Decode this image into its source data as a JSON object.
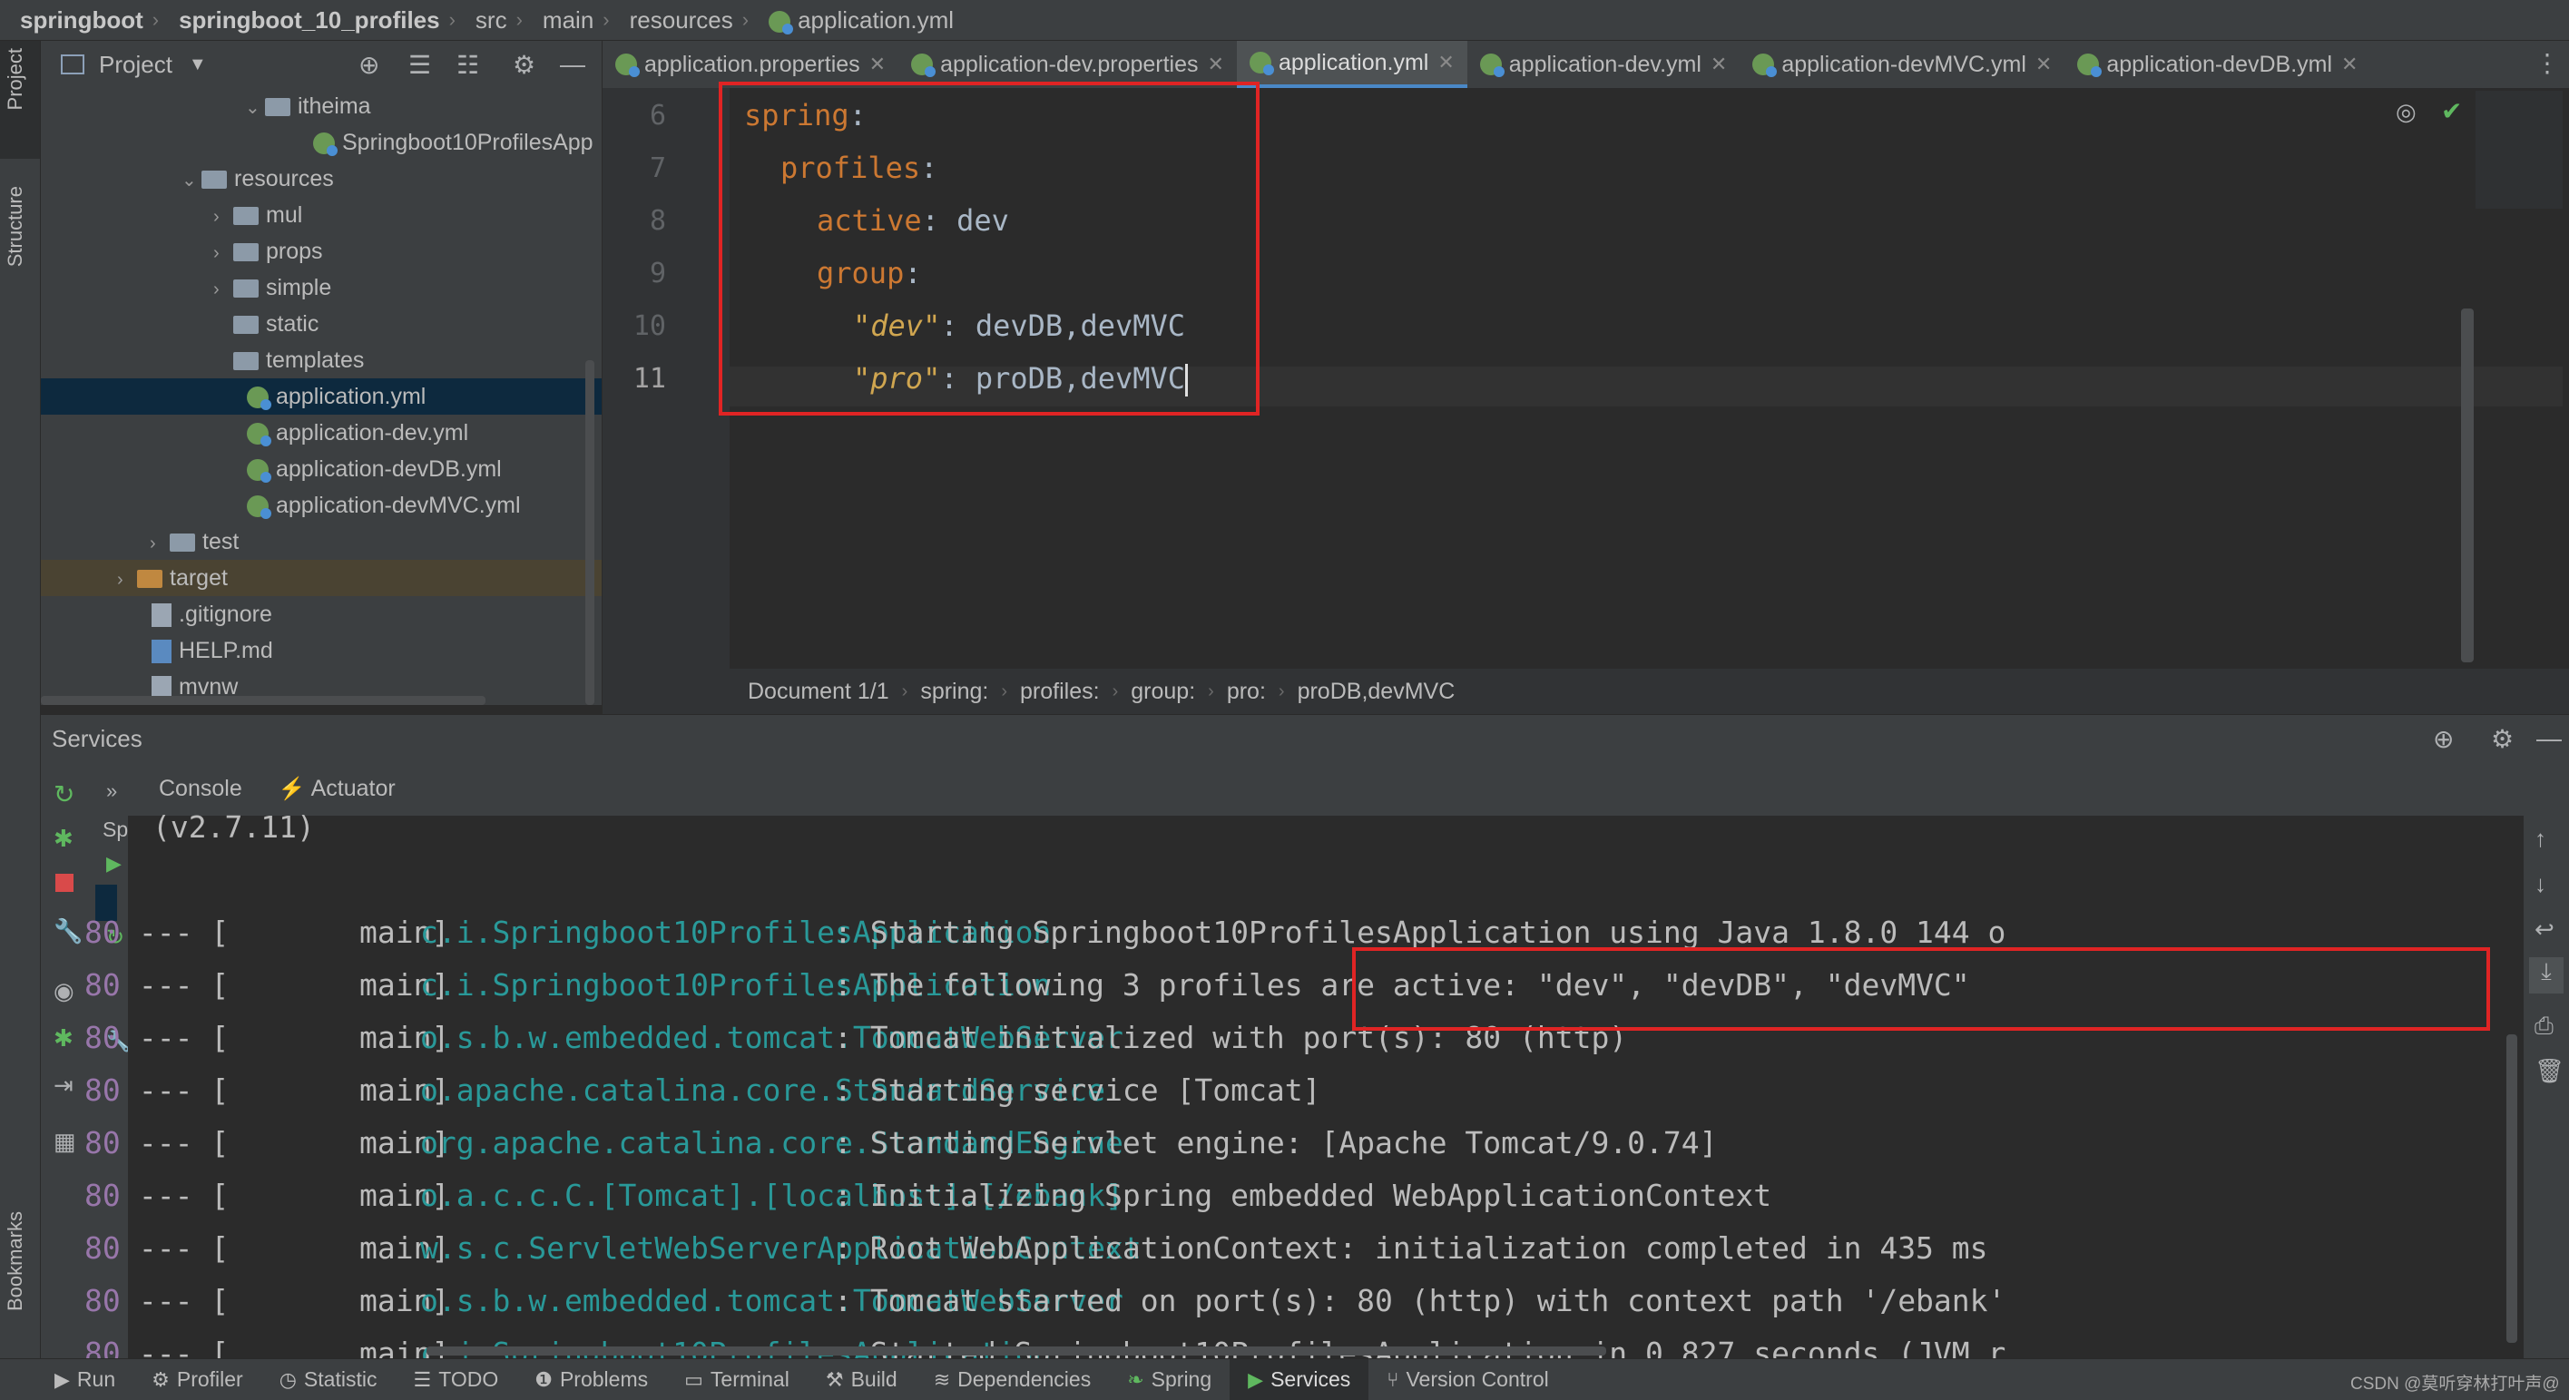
{
  "breadcrumb": [
    "springboot",
    "springboot_10_profiles",
    "src",
    "main",
    "resources",
    "application.yml"
  ],
  "left_strip": {
    "project_label": "Project",
    "structure_label": "Structure",
    "bookmarks_label": "Bookmarks"
  },
  "project_panel": {
    "title": "Project",
    "tree": [
      {
        "label": "itheima",
        "type": "folder",
        "expanded": true
      },
      {
        "label": "Springboot10ProfilesApp",
        "type": "spring-class"
      },
      {
        "label": "resources",
        "type": "folder",
        "expanded": true
      },
      {
        "label": "mul",
        "type": "folder",
        "expanded": false
      },
      {
        "label": "props",
        "type": "folder",
        "expanded": false
      },
      {
        "label": "simple",
        "type": "folder",
        "expanded": false
      },
      {
        "label": "static",
        "type": "folder"
      },
      {
        "label": "templates",
        "type": "folder"
      },
      {
        "label": "application.yml",
        "type": "spring-yml",
        "selected": true
      },
      {
        "label": "application-dev.yml",
        "type": "spring-yml"
      },
      {
        "label": "application-devDB.yml",
        "type": "spring-yml"
      },
      {
        "label": "application-devMVC.yml",
        "type": "spring-yml"
      },
      {
        "label": "test",
        "type": "folder",
        "expanded": false
      },
      {
        "label": "target",
        "type": "folder-orange",
        "expanded": false
      },
      {
        "label": ".gitignore",
        "type": "file"
      },
      {
        "label": "HELP.md",
        "type": "file"
      },
      {
        "label": "mvnw",
        "type": "file"
      }
    ]
  },
  "tabs": [
    {
      "label": "application.properties",
      "active": false
    },
    {
      "label": "application-dev.properties",
      "active": false
    },
    {
      "label": "application.yml",
      "active": true
    },
    {
      "label": "application-dev.yml",
      "active": false
    },
    {
      "label": "application-devMVC.yml",
      "active": false
    },
    {
      "label": "application-devDB.yml",
      "active": false
    }
  ],
  "editor": {
    "line_numbers": [
      "6",
      "7",
      "8",
      "9",
      "10",
      "11"
    ],
    "current_line": "11",
    "lines": [
      {
        "key": "spring",
        "sep": ":",
        "value": ""
      },
      {
        "key": "profiles",
        "sep": ":",
        "value": ""
      },
      {
        "key": "active",
        "sep": ": ",
        "value": "dev"
      },
      {
        "key": "group",
        "sep": ":",
        "value": ""
      },
      {
        "key": "\"dev\"",
        "sep": ": ",
        "value": "devDB,devMVC"
      },
      {
        "key": "\"pro\"",
        "sep": ": ",
        "value": "proDB,devMVC"
      }
    ]
  },
  "status_breadcrumb": [
    "Document 1/1",
    "spring:",
    "profiles:",
    "group:",
    "pro:",
    "proDB,devMVC"
  ],
  "services": {
    "title": "Services",
    "console_tabs": [
      "Console",
      "Actuator"
    ],
    "sp_label": "Sp",
    "version": "(v2.7.11)",
    "log_lines": [
      {
        "pid": "80",
        "sep": " --- [",
        "thread": "main]",
        "logger": "c.i.Springboot10ProfilesApplication",
        "message": ": Starting Springboot10ProfilesApplication using Java 1.8.0_144 o"
      },
      {
        "pid": "80",
        "sep": " --- [",
        "thread": "main]",
        "logger": "c.i.Springboot10ProfilesApplication",
        "message": ": The following 3 profiles are active: \"dev\", \"devDB\", \"devMVC\""
      },
      {
        "pid": "80",
        "sep": " --- [",
        "thread": "main]",
        "logger": "o.s.b.w.embedded.tomcat.TomcatWebServer",
        "message": ": Tomcat initialized with port(s): 80 (http)"
      },
      {
        "pid": "80",
        "sep": " --- [",
        "thread": "main]",
        "logger": "o.apache.catalina.core.StandardService",
        "message": ": Starting service [Tomcat]"
      },
      {
        "pid": "80",
        "sep": " --- [",
        "thread": "main]",
        "logger": "org.apache.catalina.core.StandardEngine",
        "message": ": Starting Servlet engine: [Apache Tomcat/9.0.74]"
      },
      {
        "pid": "80",
        "sep": " --- [",
        "thread": "main]",
        "logger": "o.a.c.c.C.[Tomcat].[localhost].[/ebank]",
        "message": ": Initializing Spring embedded WebApplicationContext"
      },
      {
        "pid": "80",
        "sep": " --- [",
        "thread": "main]",
        "logger": "w.s.c.ServletWebServerApplicationContext",
        "message": ": Root WebApplicationContext: initialization completed in 435 ms"
      },
      {
        "pid": "80",
        "sep": " --- [",
        "thread": "main]",
        "logger": "o.s.b.w.embedded.tomcat.TomcatWebServer",
        "message": ": Tomcat started on port(s): 80 (http) with context path '/ebank'"
      },
      {
        "pid": "80",
        "sep": " --- [",
        "thread": "main]",
        "logger": "c.i.Springboot10ProfilesApplication",
        "message": ": Started Springboot10ProfilesApplication in 0.827 seconds (JVM r"
      }
    ]
  },
  "bottom_bar": [
    {
      "label": "Run",
      "icon": "play-icon",
      "active": false
    },
    {
      "label": "Profiler",
      "icon": "profiler-icon",
      "active": false
    },
    {
      "label": "Statistic",
      "icon": "statistic-icon",
      "active": false
    },
    {
      "label": "TODO",
      "icon": "todo-icon",
      "active": false
    },
    {
      "label": "Problems",
      "icon": "problems-icon",
      "active": false
    },
    {
      "label": "Terminal",
      "icon": "terminal-icon",
      "active": false
    },
    {
      "label": "Build",
      "icon": "build-icon",
      "active": false
    },
    {
      "label": "Dependencies",
      "icon": "dependencies-icon",
      "active": false
    },
    {
      "label": "Spring",
      "icon": "spring-icon",
      "active": false
    },
    {
      "label": "Services",
      "icon": "services-icon",
      "active": true
    },
    {
      "label": "Version Control",
      "icon": "vcs-icon",
      "active": false
    }
  ],
  "watermark": "CSDN @莫听穿林打叶声@",
  "colors": {
    "accent": "#4a88c7",
    "highlight_box": "#e02424",
    "keyword": "#cc7832",
    "string": "#d0a650",
    "logger": "#299999",
    "pid": "#9876aa"
  }
}
